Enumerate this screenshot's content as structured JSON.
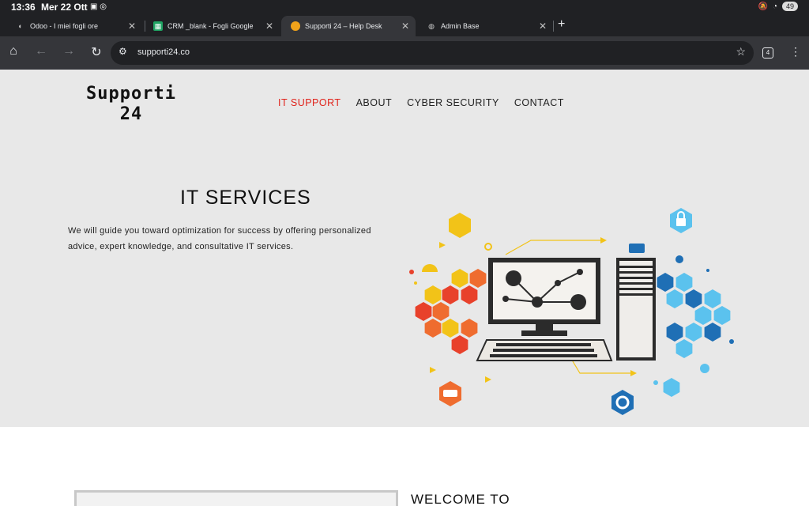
{
  "status": {
    "time": "13:36",
    "date": "Mer 22 Ott",
    "battery": "49"
  },
  "tabs": [
    {
      "title": "Odoo - I miei fogli ore",
      "icon": "odoo-icon"
    },
    {
      "title": "CRM _blank - Fogli Google",
      "icon": "sheets-icon"
    },
    {
      "title": "Supporti 24 – Help Desk",
      "icon": "site-favicon"
    },
    {
      "title": "Admin Base",
      "icon": "globe-icon"
    }
  ],
  "toolbar": {
    "url": "supporti24.co",
    "tab_count": "4"
  },
  "site": {
    "logo_line1": "Supporti",
    "logo_line2": "24",
    "nav": [
      "IT SUPPORT",
      "ABOUT",
      "CYBER SECURITY",
      "CONTACT"
    ],
    "hero_title": "IT SERVICES",
    "hero_text": "We will guide you toward optimization for success by offering personalized advice, expert knowledge, and consultative IT services.",
    "welcome": "WELCOME TO"
  },
  "colors": {
    "accent_red": "#e0231b",
    "hex_yellow": "#f2c318",
    "hex_orange": "#ef6c2f",
    "hex_red": "#e8412b",
    "hex_blue": "#1f6fb5",
    "hex_light_blue": "#5bc2ee"
  }
}
